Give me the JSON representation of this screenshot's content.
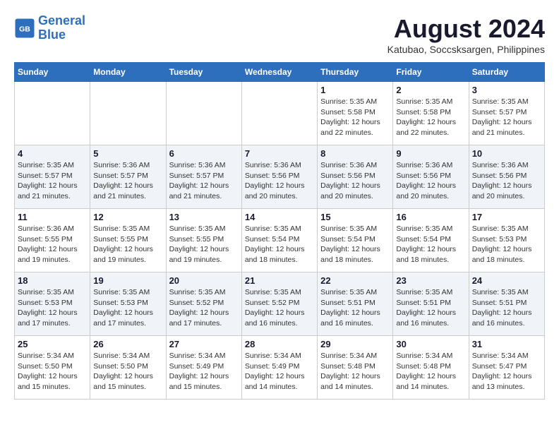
{
  "header": {
    "logo_line1": "General",
    "logo_line2": "Blue",
    "title": "August 2024",
    "subtitle": "Katubao, Soccsksargen, Philippines"
  },
  "calendar": {
    "days_of_week": [
      "Sunday",
      "Monday",
      "Tuesday",
      "Wednesday",
      "Thursday",
      "Friday",
      "Saturday"
    ],
    "weeks": [
      [
        {
          "day": "",
          "info": ""
        },
        {
          "day": "",
          "info": ""
        },
        {
          "day": "",
          "info": ""
        },
        {
          "day": "",
          "info": ""
        },
        {
          "day": "1",
          "info": "Sunrise: 5:35 AM\nSunset: 5:58 PM\nDaylight: 12 hours\nand 22 minutes."
        },
        {
          "day": "2",
          "info": "Sunrise: 5:35 AM\nSunset: 5:58 PM\nDaylight: 12 hours\nand 22 minutes."
        },
        {
          "day": "3",
          "info": "Sunrise: 5:35 AM\nSunset: 5:57 PM\nDaylight: 12 hours\nand 21 minutes."
        }
      ],
      [
        {
          "day": "4",
          "info": "Sunrise: 5:35 AM\nSunset: 5:57 PM\nDaylight: 12 hours\nand 21 minutes."
        },
        {
          "day": "5",
          "info": "Sunrise: 5:36 AM\nSunset: 5:57 PM\nDaylight: 12 hours\nand 21 minutes."
        },
        {
          "day": "6",
          "info": "Sunrise: 5:36 AM\nSunset: 5:57 PM\nDaylight: 12 hours\nand 21 minutes."
        },
        {
          "day": "7",
          "info": "Sunrise: 5:36 AM\nSunset: 5:56 PM\nDaylight: 12 hours\nand 20 minutes."
        },
        {
          "day": "8",
          "info": "Sunrise: 5:36 AM\nSunset: 5:56 PM\nDaylight: 12 hours\nand 20 minutes."
        },
        {
          "day": "9",
          "info": "Sunrise: 5:36 AM\nSunset: 5:56 PM\nDaylight: 12 hours\nand 20 minutes."
        },
        {
          "day": "10",
          "info": "Sunrise: 5:36 AM\nSunset: 5:56 PM\nDaylight: 12 hours\nand 20 minutes."
        }
      ],
      [
        {
          "day": "11",
          "info": "Sunrise: 5:36 AM\nSunset: 5:55 PM\nDaylight: 12 hours\nand 19 minutes."
        },
        {
          "day": "12",
          "info": "Sunrise: 5:35 AM\nSunset: 5:55 PM\nDaylight: 12 hours\nand 19 minutes."
        },
        {
          "day": "13",
          "info": "Sunrise: 5:35 AM\nSunset: 5:55 PM\nDaylight: 12 hours\nand 19 minutes."
        },
        {
          "day": "14",
          "info": "Sunrise: 5:35 AM\nSunset: 5:54 PM\nDaylight: 12 hours\nand 18 minutes."
        },
        {
          "day": "15",
          "info": "Sunrise: 5:35 AM\nSunset: 5:54 PM\nDaylight: 12 hours\nand 18 minutes."
        },
        {
          "day": "16",
          "info": "Sunrise: 5:35 AM\nSunset: 5:54 PM\nDaylight: 12 hours\nand 18 minutes."
        },
        {
          "day": "17",
          "info": "Sunrise: 5:35 AM\nSunset: 5:53 PM\nDaylight: 12 hours\nand 18 minutes."
        }
      ],
      [
        {
          "day": "18",
          "info": "Sunrise: 5:35 AM\nSunset: 5:53 PM\nDaylight: 12 hours\nand 17 minutes."
        },
        {
          "day": "19",
          "info": "Sunrise: 5:35 AM\nSunset: 5:53 PM\nDaylight: 12 hours\nand 17 minutes."
        },
        {
          "day": "20",
          "info": "Sunrise: 5:35 AM\nSunset: 5:52 PM\nDaylight: 12 hours\nand 17 minutes."
        },
        {
          "day": "21",
          "info": "Sunrise: 5:35 AM\nSunset: 5:52 PM\nDaylight: 12 hours\nand 16 minutes."
        },
        {
          "day": "22",
          "info": "Sunrise: 5:35 AM\nSunset: 5:51 PM\nDaylight: 12 hours\nand 16 minutes."
        },
        {
          "day": "23",
          "info": "Sunrise: 5:35 AM\nSunset: 5:51 PM\nDaylight: 12 hours\nand 16 minutes."
        },
        {
          "day": "24",
          "info": "Sunrise: 5:35 AM\nSunset: 5:51 PM\nDaylight: 12 hours\nand 16 minutes."
        }
      ],
      [
        {
          "day": "25",
          "info": "Sunrise: 5:34 AM\nSunset: 5:50 PM\nDaylight: 12 hours\nand 15 minutes."
        },
        {
          "day": "26",
          "info": "Sunrise: 5:34 AM\nSunset: 5:50 PM\nDaylight: 12 hours\nand 15 minutes."
        },
        {
          "day": "27",
          "info": "Sunrise: 5:34 AM\nSunset: 5:49 PM\nDaylight: 12 hours\nand 15 minutes."
        },
        {
          "day": "28",
          "info": "Sunrise: 5:34 AM\nSunset: 5:49 PM\nDaylight: 12 hours\nand 14 minutes."
        },
        {
          "day": "29",
          "info": "Sunrise: 5:34 AM\nSunset: 5:48 PM\nDaylight: 12 hours\nand 14 minutes."
        },
        {
          "day": "30",
          "info": "Sunrise: 5:34 AM\nSunset: 5:48 PM\nDaylight: 12 hours\nand 14 minutes."
        },
        {
          "day": "31",
          "info": "Sunrise: 5:34 AM\nSunset: 5:47 PM\nDaylight: 12 hours\nand 13 minutes."
        }
      ]
    ]
  }
}
